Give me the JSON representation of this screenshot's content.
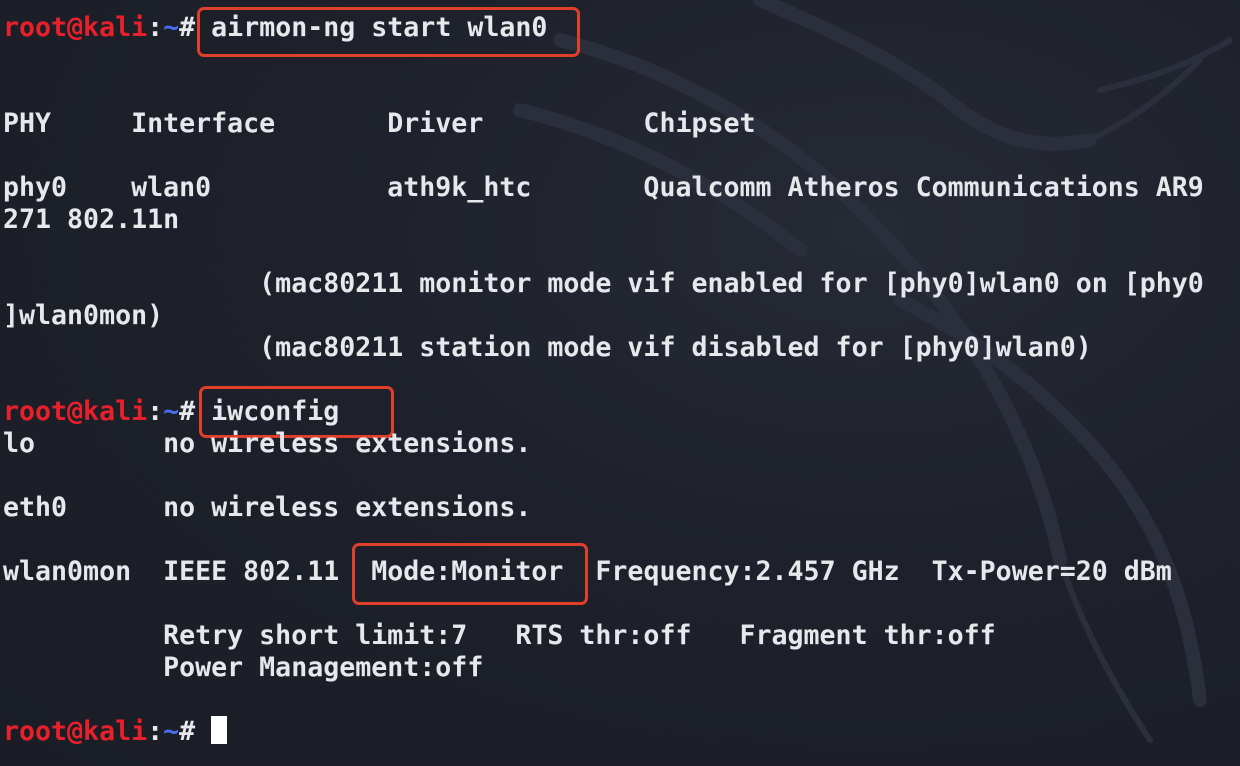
{
  "prompt": {
    "user_host": "root@kali",
    "separator": ":",
    "path": "~",
    "symbol": "# "
  },
  "commands": {
    "airmon": "airmon-ng start wlan0",
    "iwconfig": "iwconfig"
  },
  "output": {
    "table_header": "PHY     Interface       Driver          Chipset",
    "table_row": "phy0    wlan0           ath9k_htc       Qualcomm Atheros Communications AR9",
    "table_row_wrap": "271 802.11n",
    "monitor_line1": "                (mac80211 monitor mode vif enabled for [phy0]wlan0 on [phy0",
    "monitor_line1_wrap": "]wlan0mon)",
    "monitor_line2": "                (mac80211 station mode vif disabled for [phy0]wlan0)",
    "lo_line": "lo        no wireless extensions.",
    "eth0_line": "eth0      no wireless extensions.",
    "wlan_prefix": "wlan0mon  IEEE 802.11  ",
    "wlan_mode": "Mode:Monitor",
    "wlan_suffix": "  Frequency:2.457 GHz  Tx-Power=20 dBm",
    "retry_line": "          Retry short limit:7   RTS thr:off   Fragment thr:off",
    "power_line": "          Power Management:off"
  },
  "colors": {
    "background": "#1e212b",
    "text": "#e6e8ec",
    "user_host": "#e8202a",
    "path": "#4a6cf0",
    "highlight_box": "#e0402a"
  }
}
